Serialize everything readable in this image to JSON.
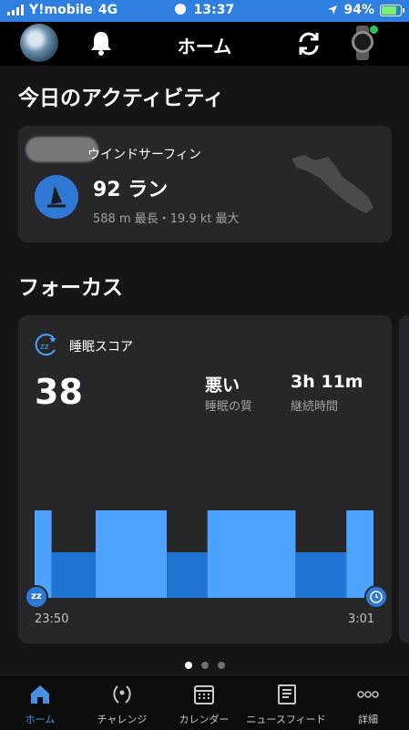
{
  "status_bar": {
    "carrier": "Y!mobile",
    "network": "4G",
    "time": "13:37",
    "battery": "94%",
    "battery_level": 0.94
  },
  "header": {
    "title": "ホーム",
    "icons": [
      "avatar",
      "bell-icon",
      "sync-icon",
      "watch-icon"
    ]
  },
  "activity_section": {
    "title": "今日のアクティビティ",
    "card": {
      "sport": "ウインドサーフィン",
      "runs": "92 ラン",
      "details": "588 m 最長・19.9 kt 最大",
      "icon": "windsurf-icon"
    }
  },
  "focus_section": {
    "title": "フォーカス",
    "sleep_card": {
      "title": "睡眠スコア",
      "score": "38",
      "quality_value": "悪い",
      "quality_label": "睡眠の質",
      "duration_value": "3h 11m",
      "duration_label": "継続時間",
      "start_time": "23:50",
      "end_time": "3:01",
      "start_marker": "zz",
      "hypnogram": [
        {
          "stage": "light",
          "fraction": 0.05
        },
        {
          "stage": "deep",
          "fraction": 0.13
        },
        {
          "stage": "light",
          "fraction": 0.21
        },
        {
          "stage": "deep",
          "fraction": 0.12
        },
        {
          "stage": "light",
          "fraction": 0.26
        },
        {
          "stage": "deep",
          "fraction": 0.15
        },
        {
          "stage": "light",
          "fraction": 0.08
        }
      ],
      "colors": {
        "light": "#4da3ff",
        "deep": "#1f74d1"
      }
    }
  },
  "pager": {
    "pages": 3,
    "active": 0
  },
  "tabs": [
    {
      "label": "ホーム",
      "icon": "home-icon",
      "active": true
    },
    {
      "label": "チャレンジ",
      "icon": "laurel-icon",
      "active": false
    },
    {
      "label": "カレンダー",
      "icon": "calendar-icon",
      "active": false
    },
    {
      "label": "ニュースフィード",
      "icon": "news-icon",
      "active": false
    },
    {
      "label": "詳細",
      "icon": "more-icon",
      "active": false
    }
  ]
}
